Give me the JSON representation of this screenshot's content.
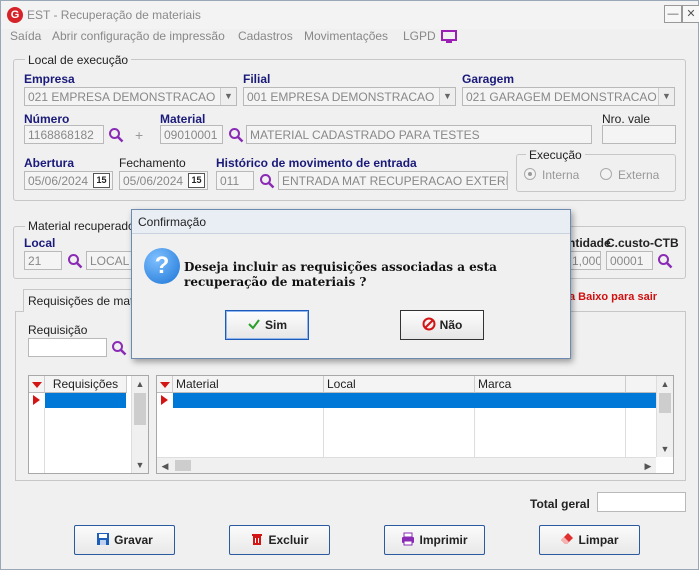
{
  "window": {
    "title": "EST - Recuperação de materiais",
    "minimize": "—",
    "close": "✕"
  },
  "menu": [
    "Saída",
    "Abrir configuração de impressão",
    "Cadastros",
    "Movimentações",
    "LGPD"
  ],
  "local_execucao": {
    "legend": "Local de execução",
    "empresa_label": "Empresa",
    "empresa_value": "021 EMPRESA DEMONSTRACAO",
    "filial_label": "Filial",
    "filial_value": "001 EMPRESA DEMONSTRACAO",
    "garagem_label": "Garagem",
    "garagem_value": "021 GARAGEM DEMONSTRACAO",
    "numero_label": "Número",
    "numero_value": "1168868182",
    "material_label": "Material",
    "material_code": "09010001",
    "material_desc": "MATERIAL CADASTRADO PARA TESTES",
    "nro_vale_label": "Nro. vale",
    "nro_vale_value": "",
    "abertura_label": "Abertura",
    "abertura_value": "05/06/2024",
    "fechamento_label": "Fechamento",
    "fechamento_value": "05/06/2024",
    "historico_label": "Histórico de movimento de entrada",
    "historico_code": "011",
    "historico_desc": "ENTRADA MAT RECUPERACAO EXTERNA",
    "calendar_icon_text": "15",
    "execucao_legend": "Execução",
    "execucao_interna": "Interna",
    "execucao_externa": "Externa"
  },
  "material_recuperado": {
    "legend": "Material recuperado",
    "local_label": "Local",
    "local_code": "21",
    "local_desc": "LOCAL D",
    "quantidade_label": "ntidade",
    "quantidade_value": "1,000",
    "ccusto_label": "C.custo-CTB",
    "ccusto_value": "00001"
  },
  "requisicoes": {
    "tab_label": "Requisições de mater",
    "hint": "a Baixo para sair",
    "requisicao_label": "Requisição",
    "requisicao_value": "",
    "grid1_header": "Requisições",
    "grid2_headers": [
      "Material",
      "Local",
      "Marca"
    ]
  },
  "total": {
    "label": "Total geral",
    "value": ""
  },
  "buttons": {
    "gravar": "Gravar",
    "excluir": "Excluir",
    "imprimir": "Imprimir",
    "limpar": "Limpar"
  },
  "dialog": {
    "title": "Confirmação",
    "icon": "?",
    "message": "Deseja incluir as requisições associadas a esta recuperação de materiais ?",
    "yes": "Sim",
    "no": "Não"
  },
  "colors": {
    "accent": "#0078d7",
    "label_blue": "#1a1a7a",
    "hint_red": "#d01010"
  }
}
